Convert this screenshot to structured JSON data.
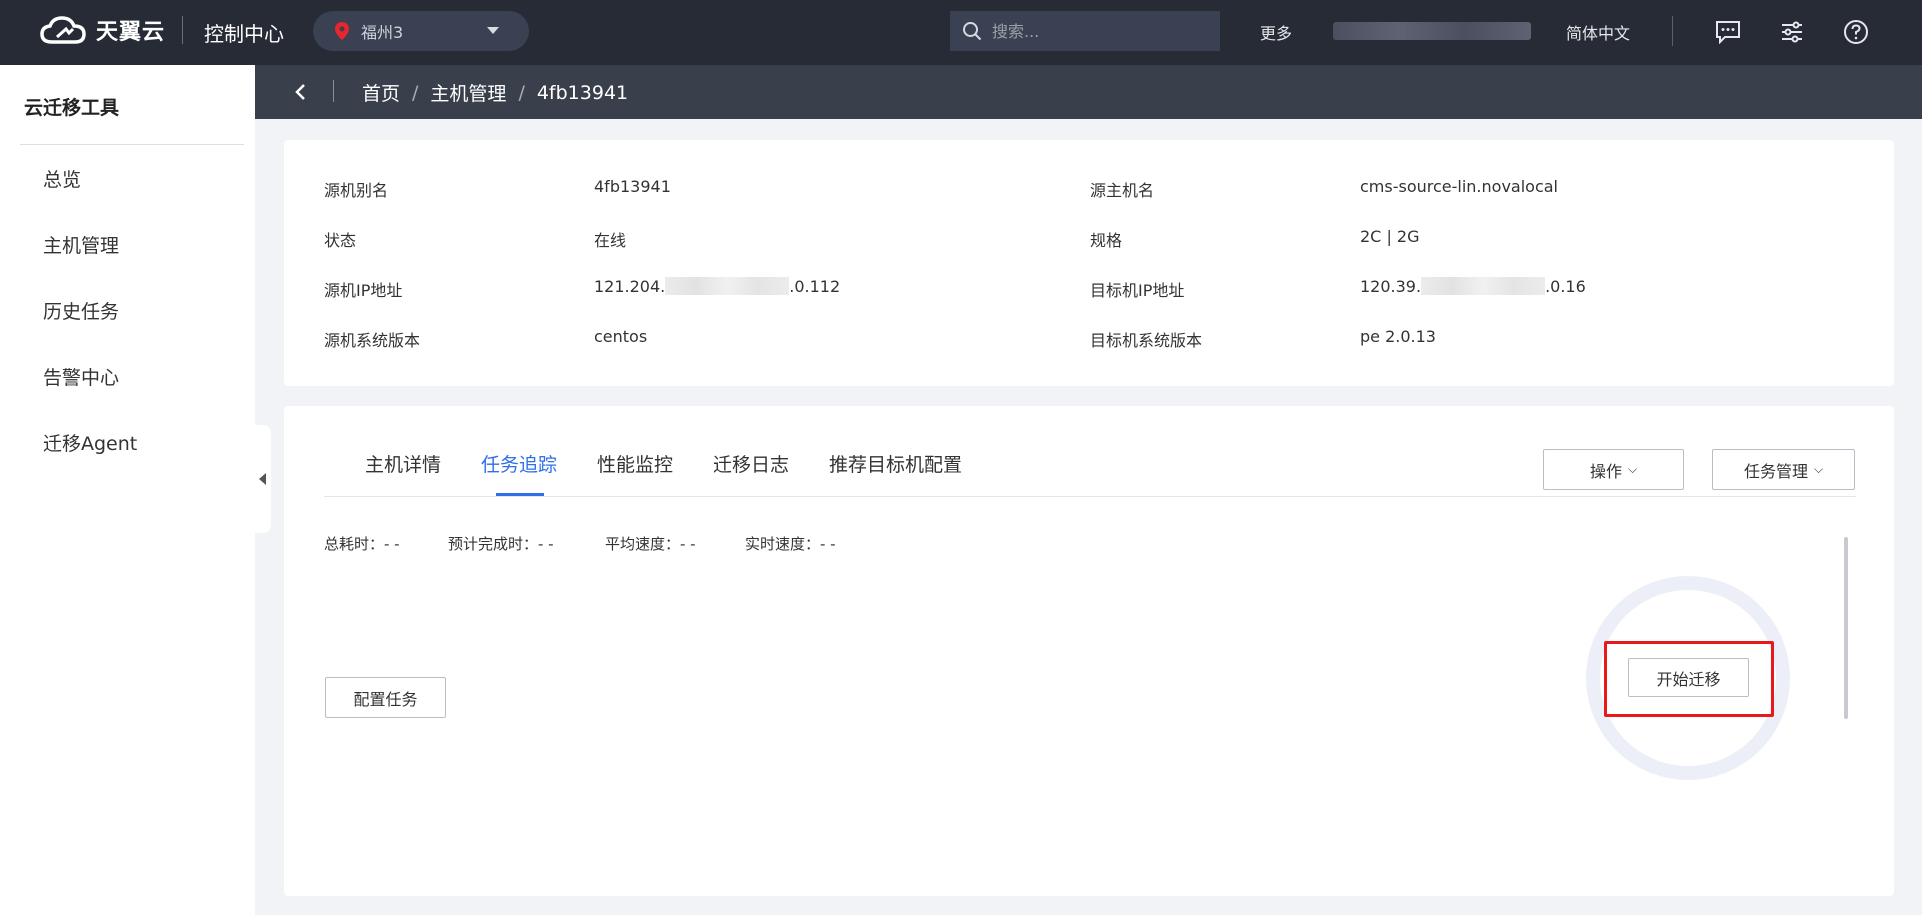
{
  "header": {
    "brand": "天翼云",
    "console": "控制中心",
    "region": "福州3",
    "search_placeholder": "搜索...",
    "more": "更多",
    "language": "简体中文",
    "icons": [
      "message-icon",
      "settings-sliders-icon",
      "help-icon"
    ]
  },
  "sidebar": {
    "title": "云迁移工具",
    "items": [
      {
        "label": "总览"
      },
      {
        "label": "主机管理"
      },
      {
        "label": "历史任务"
      },
      {
        "label": "告警中心"
      },
      {
        "label": "迁移Agent"
      }
    ]
  },
  "breadcrumb": {
    "items": [
      "首页",
      "主机管理",
      "4fb13941"
    ]
  },
  "info": {
    "source_alias_label": "源机别名",
    "source_alias": "4fb13941",
    "source_host_label": "源主机名",
    "source_host": "cms-source-lin.novalocal",
    "status_label": "状态",
    "status": "在线",
    "spec_label": "规格",
    "spec": "2C | 2G",
    "source_ip_label": "源机IP地址",
    "source_ip_prefix": "121.204.",
    "source_ip_suffix": ".0.112",
    "target_ip_label": "目标机IP地址",
    "target_ip_prefix": "120.39.",
    "target_ip_suffix": ".0.16",
    "source_os_label": "源机系统版本",
    "source_os": "centos",
    "target_os_label": "目标机系统版本",
    "target_os": "pe 2.0.13"
  },
  "tabs": [
    {
      "label": "主机详情",
      "active": false
    },
    {
      "label": "任务追踪",
      "active": true
    },
    {
      "label": "性能监控",
      "active": false
    },
    {
      "label": "迁移日志",
      "active": false
    },
    {
      "label": "推荐目标机配置",
      "active": false
    }
  ],
  "actions": {
    "operate": "操作",
    "task_manage": "任务管理",
    "configure_task": "配置任务",
    "start_migration": "开始迁移"
  },
  "stats": {
    "total_time": "总耗时：- -",
    "estimated_finish": "预计完成时：- -",
    "avg_speed": "平均速度：- -",
    "realtime_speed": "实时速度：- -"
  },
  "colors": {
    "topbar": "#262b35",
    "breadcrumb_bar": "#3a3f4c",
    "accent": "#2f6fe8",
    "highlight": "#e8191a"
  }
}
